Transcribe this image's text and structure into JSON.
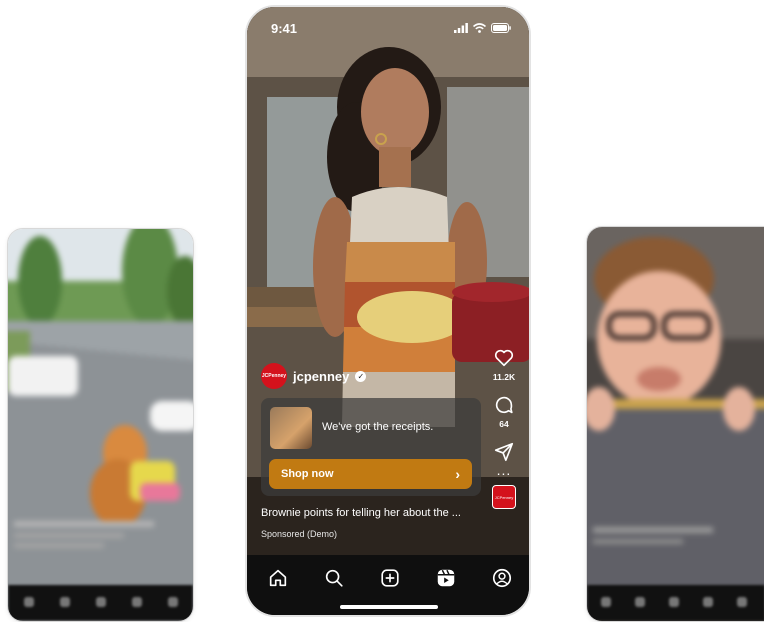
{
  "main_phone": {
    "status_bar": {
      "time": "9:41"
    },
    "account": {
      "logo_text": "JCPenney",
      "name": "jcpenney"
    },
    "ad_card": {
      "message": "We've got the receipts.",
      "cta_label": "Shop now"
    },
    "caption": "Brownie points for telling her about the ...",
    "sponsored_label": "Sponsored (Demo)",
    "actions": {
      "like_count": "11.2K",
      "comment_count": "64",
      "more": "..."
    },
    "brand_badge_text": "JCPenney",
    "bottom_nav": [
      "home-icon",
      "search-icon",
      "create-icon",
      "reels-icon",
      "profile-icon"
    ]
  },
  "colors": {
    "cta": "#c17a12",
    "brand_red": "#d4121c",
    "nav_bg": "#0f0f0f"
  }
}
